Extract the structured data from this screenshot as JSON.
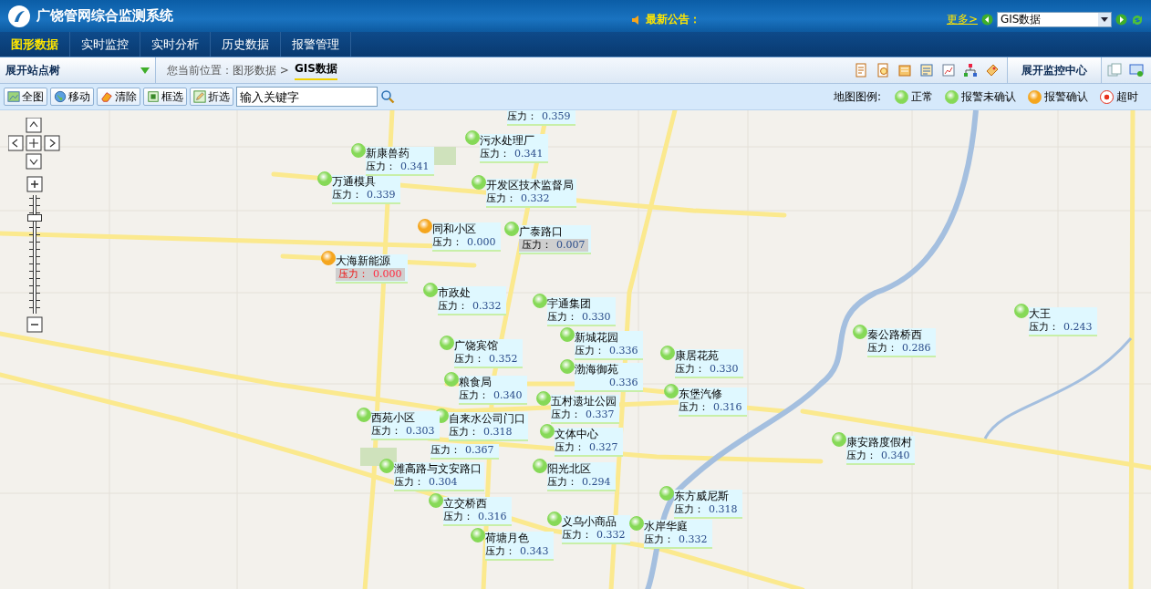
{
  "header": {
    "title": "广饶管网综合监测系统",
    "notice_label": "最新公告：",
    "more_link": "更多>",
    "view_select": "GIS数据"
  },
  "nav": [
    {
      "label": "图形数据",
      "selected": true
    },
    {
      "label": "实时监控",
      "selected": false
    },
    {
      "label": "实时分析",
      "selected": false
    },
    {
      "label": "历史数据",
      "selected": false
    },
    {
      "label": "报警管理",
      "selected": false
    }
  ],
  "subbar": {
    "tree_toggle": "展开站点树",
    "breadcrumb_prefix": "您当前位置：图形数据 >",
    "breadcrumb_current": "GIS数据",
    "monitor_toggle": "展开监控中心"
  },
  "toolbar": {
    "buttons": [
      "全图",
      "移动",
      "清除",
      "框选",
      "折选"
    ],
    "search": {
      "placeholder": "输入关键字"
    }
  },
  "legend": {
    "title": "地图图例:",
    "items": [
      {
        "label": "正常",
        "kind": "ball",
        "color": "#86d957"
      },
      {
        "label": "报警未确认",
        "kind": "ball",
        "color": "#86d957"
      },
      {
        "label": "报警确认",
        "kind": "ball",
        "color": "#f5a61e"
      },
      {
        "label": "超时",
        "kind": "ring",
        "color": "#e8321e"
      }
    ]
  },
  "zoom": {
    "level": 0.83
  },
  "markers": [
    {
      "kind": "plain",
      "reading_label": "压力：",
      "reading": "0.359"
    },
    {
      "kind": "plain",
      "color": "#86d957",
      "name": "污水处理厂",
      "reading_label": "压力：",
      "reading": "0.341"
    },
    {
      "kind": "plain",
      "color": "#86d957",
      "name": "新康兽药",
      "reading_label": "压力：",
      "reading": "0.341"
    },
    {
      "kind": "plain",
      "color": "#86d957",
      "name": "万通模具",
      "reading_label": "压力：",
      "reading": "0.339"
    },
    {
      "kind": "plain",
      "color": "#86d957",
      "name": "开发区技术监督局",
      "reading_label": "压力：",
      "reading": "0.332"
    },
    {
      "kind": "plain",
      "color": "#f5a61e",
      "name": "同和小区",
      "reading_label": "压力：",
      "reading": "0.000"
    },
    {
      "kind": "stale",
      "color": "#86d957",
      "name": "广泰路口",
      "reading_label": "压力：",
      "reading": "0.007"
    },
    {
      "kind": "alarm",
      "color": "#f5a61e",
      "name": "大海新能源",
      "reading_label": "压力：",
      "reading": "0.000"
    },
    {
      "kind": "plain",
      "color": "#86d957",
      "name": "市政处",
      "reading_label": "压力：",
      "reading": "0.332"
    },
    {
      "kind": "plain",
      "color": "#86d957",
      "name": "宇通集团",
      "reading_label": "压力：",
      "reading": "0.330"
    },
    {
      "kind": "plain",
      "color": "#86d957",
      "name": "大王",
      "reading_label": "压力：",
      "reading": "0.243"
    },
    {
      "kind": "plain",
      "color": "#86d957",
      "name": "秦公路桥西",
      "reading_label": "压力：",
      "reading": "0.286"
    },
    {
      "kind": "plain",
      "color": "#86d957",
      "name": "广饶宾馆",
      "reading_label": "压力：",
      "reading": "0.352"
    },
    {
      "kind": "plain",
      "color": "#86d957",
      "name": "新城花园",
      "reading_label": "压力：",
      "reading": "0.336"
    },
    {
      "kind": "plain",
      "color": "#86d957",
      "name": "康居花苑",
      "reading_label": "压力：",
      "reading": "0.330"
    },
    {
      "kind": "plain",
      "color": "#86d957",
      "name": "渤海御苑",
      "reading": "0.336"
    },
    {
      "kind": "plain",
      "color": "#86d957",
      "name": "粮食局",
      "reading_label": "压力：",
      "reading": "0.340"
    },
    {
      "kind": "plain",
      "color": "#86d957",
      "name": "五村遗址公园",
      "reading_label": "压力：",
      "reading": "0.337"
    },
    {
      "kind": "plain",
      "color": "#86d957",
      "name": "东堡汽修",
      "reading_label": "压力：",
      "reading": "0.316"
    },
    {
      "kind": "plain",
      "color": "#86d957",
      "name": "西苑小区",
      "reading_label": "压力：",
      "reading": "0.303"
    },
    {
      "kind": "plain",
      "color": "#86d957",
      "name": "自来水公司门口",
      "reading_label": "压力：",
      "reading": "0.318"
    },
    {
      "kind": "plain",
      "reading_label": "压力：",
      "reading": "0.367"
    },
    {
      "kind": "plain",
      "color": "#86d957",
      "name": "文体中心",
      "reading_label": "压力：",
      "reading": "0.327"
    },
    {
      "kind": "plain",
      "color": "#86d957",
      "name": "康安路度假村",
      "reading_label": "压力：",
      "reading": "0.340"
    },
    {
      "kind": "plain",
      "color": "#86d957",
      "name": "潍高路与文安路口",
      "reading_label": "压力：",
      "reading": "0.304"
    },
    {
      "kind": "plain",
      "color": "#86d957",
      "name": "阳光北区",
      "reading_label": "压力：",
      "reading": "0.294"
    },
    {
      "kind": "plain",
      "color": "#86d957",
      "name": "立交桥西",
      "reading_label": "压力：",
      "reading": "0.316"
    },
    {
      "kind": "plain",
      "color": "#86d957",
      "name": "东方威尼斯",
      "reading_label": "压力：",
      "reading": "0.318"
    },
    {
      "kind": "plain",
      "color": "#86d957",
      "name": "水岸华庭",
      "reading_label": "压力：",
      "reading": "0.332"
    },
    {
      "kind": "plain",
      "color": "#86d957",
      "name": "荷塘月色",
      "reading_label": "压力：",
      "reading": "0.343"
    },
    {
      "kind": "plain",
      "color": "#86d957",
      "name": "义乌小商品",
      "reading_label": "压力：",
      "reading": "0.332"
    }
  ]
}
